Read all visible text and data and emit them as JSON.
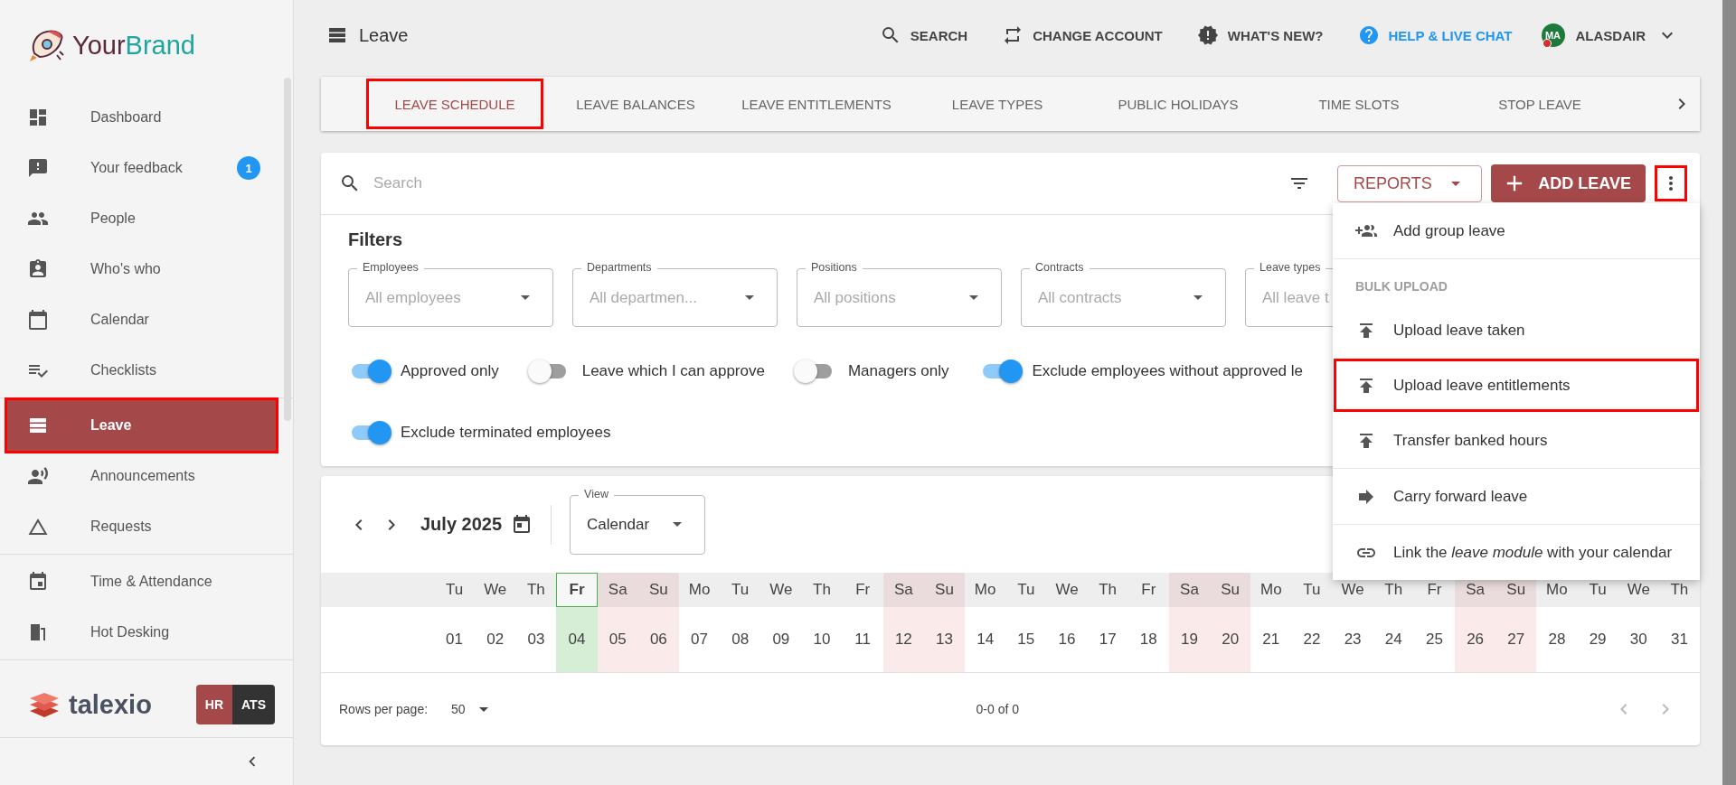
{
  "sidebar": {
    "brand": {
      "first": "Your",
      "second": "Brand"
    },
    "nav_sections": [
      {
        "items": [
          {
            "label": "Dashboard",
            "selected": false,
            "highlighted": false
          },
          {
            "label": "Your feedback",
            "selected": false,
            "highlighted": false,
            "badge": "1"
          },
          {
            "label": "People",
            "selected": false,
            "highlighted": false
          },
          {
            "label": "Who's who",
            "selected": false,
            "highlighted": false
          },
          {
            "label": "Calendar",
            "selected": false,
            "highlighted": false
          },
          {
            "label": "Checklists",
            "selected": false,
            "highlighted": false
          }
        ]
      },
      {
        "items": [
          {
            "label": "Leave",
            "selected": true,
            "highlighted": true
          },
          {
            "label": "Announcements",
            "selected": false,
            "highlighted": false
          },
          {
            "label": "Requests",
            "selected": false,
            "highlighted": false
          }
        ]
      },
      {
        "items": [
          {
            "label": "Time & Attendance",
            "selected": false,
            "highlighted": false
          },
          {
            "label": "Hot Desking",
            "selected": false,
            "highlighted": false
          }
        ]
      }
    ],
    "footer": {
      "product": "talexio",
      "modules": [
        {
          "label": "HR",
          "selected": true
        },
        {
          "label": "ATS",
          "selected": false
        }
      ]
    }
  },
  "header": {
    "title": "Leave",
    "actions": [
      {
        "label": "SEARCH",
        "kind": "plain"
      },
      {
        "label": "CHANGE ACCOUNT",
        "kind": "plain"
      },
      {
        "label": "WHAT'S NEW?",
        "kind": "plain"
      },
      {
        "label": "HELP & LIVE CHAT",
        "kind": "link"
      }
    ],
    "user": {
      "initials": "MA",
      "name": "ALASDAIR"
    }
  },
  "tabs": [
    {
      "label": "LEAVE SCHEDULE",
      "selected": true,
      "highlighted": true
    },
    {
      "label": "LEAVE BALANCES",
      "selected": false,
      "highlighted": false
    },
    {
      "label": "LEAVE ENTITLEMENTS",
      "selected": false,
      "highlighted": false
    },
    {
      "label": "LEAVE TYPES",
      "selected": false,
      "highlighted": false
    },
    {
      "label": "PUBLIC HOLIDAYS",
      "selected": false,
      "highlighted": false
    },
    {
      "label": "TIME SLOTS",
      "selected": false,
      "highlighted": false
    },
    {
      "label": "STOP LEAVE",
      "selected": false,
      "highlighted": false
    }
  ],
  "toolbar": {
    "search": {
      "placeholder": "Search"
    },
    "reports_button": "REPORTS",
    "add_button": "ADD LEAVE",
    "more_button": {
      "highlighted": true
    }
  },
  "filters": {
    "title": "Filters",
    "dropdowns": [
      {
        "label": "Employees",
        "placeholder": "All employees"
      },
      {
        "label": "Departments",
        "placeholder": "All departmen..."
      },
      {
        "label": "Positions",
        "placeholder": "All positions"
      },
      {
        "label": "Contracts",
        "placeholder": "All contracts"
      },
      {
        "label": "Leave types",
        "placeholder": "All leave t"
      }
    ],
    "switches": [
      {
        "label": "Approved only",
        "on": true
      },
      {
        "label": "Leave which I can approve",
        "on": false
      },
      {
        "label": "Managers only",
        "on": false
      },
      {
        "label": "Exclude employees without approved le",
        "on": true
      },
      {
        "label": "Exclude terminated employees",
        "on": true
      }
    ]
  },
  "menu": {
    "sections": [
      {
        "items": [
          {
            "label": "Add group leave",
            "highlighted": false
          }
        ]
      },
      {
        "title": "BULK UPLOAD",
        "items": [
          {
            "label": "Upload leave taken",
            "highlighted": false
          },
          {
            "label": "Upload leave entitlements",
            "highlighted": true
          },
          {
            "label": "Transfer banked hours",
            "highlighted": false
          }
        ]
      },
      {
        "items": [
          {
            "label": "Carry forward leave",
            "highlighted": false
          }
        ]
      },
      {
        "items": [
          {
            "label": "Link the *leave module* with your calendar",
            "highlighted": false
          }
        ]
      }
    ]
  },
  "calendar": {
    "month": "July 2025",
    "view": {
      "label": "View",
      "value": "Calendar"
    },
    "days": [
      {
        "weekday": "Tu",
        "date": "01",
        "weekend": false,
        "today": false
      },
      {
        "weekday": "We",
        "date": "02",
        "weekend": false,
        "today": false
      },
      {
        "weekday": "Th",
        "date": "03",
        "weekend": false,
        "today": false
      },
      {
        "weekday": "Fr",
        "date": "04",
        "weekend": false,
        "today": true
      },
      {
        "weekday": "Sa",
        "date": "05",
        "weekend": true,
        "today": false
      },
      {
        "weekday": "Su",
        "date": "06",
        "weekend": true,
        "today": false
      },
      {
        "weekday": "Mo",
        "date": "07",
        "weekend": false,
        "today": false
      },
      {
        "weekday": "Tu",
        "date": "08",
        "weekend": false,
        "today": false
      },
      {
        "weekday": "We",
        "date": "09",
        "weekend": false,
        "today": false
      },
      {
        "weekday": "Th",
        "date": "10",
        "weekend": false,
        "today": false
      },
      {
        "weekday": "Fr",
        "date": "11",
        "weekend": false,
        "today": false
      },
      {
        "weekday": "Sa",
        "date": "12",
        "weekend": true,
        "today": false
      },
      {
        "weekday": "Su",
        "date": "13",
        "weekend": true,
        "today": false
      },
      {
        "weekday": "Mo",
        "date": "14",
        "weekend": false,
        "today": false
      },
      {
        "weekday": "Tu",
        "date": "15",
        "weekend": false,
        "today": false
      },
      {
        "weekday": "We",
        "date": "16",
        "weekend": false,
        "today": false
      },
      {
        "weekday": "Th",
        "date": "17",
        "weekend": false,
        "today": false
      },
      {
        "weekday": "Fr",
        "date": "18",
        "weekend": false,
        "today": false
      },
      {
        "weekday": "Sa",
        "date": "19",
        "weekend": true,
        "today": false
      },
      {
        "weekday": "Su",
        "date": "20",
        "weekend": true,
        "today": false
      },
      {
        "weekday": "Mo",
        "date": "21",
        "weekend": false,
        "today": false
      },
      {
        "weekday": "Tu",
        "date": "22",
        "weekend": false,
        "today": false
      },
      {
        "weekday": "We",
        "date": "23",
        "weekend": false,
        "today": false
      },
      {
        "weekday": "Th",
        "date": "24",
        "weekend": false,
        "today": false
      },
      {
        "weekday": "Fr",
        "date": "25",
        "weekend": false,
        "today": false
      },
      {
        "weekday": "Sa",
        "date": "26",
        "weekend": true,
        "today": false
      },
      {
        "weekday": "Su",
        "date": "27",
        "weekend": true,
        "today": false
      },
      {
        "weekday": "Mo",
        "date": "28",
        "weekend": false,
        "today": false
      },
      {
        "weekday": "Tu",
        "date": "29",
        "weekend": false,
        "today": false
      },
      {
        "weekday": "We",
        "date": "30",
        "weekend": false,
        "today": false
      },
      {
        "weekday": "Th",
        "date": "31",
        "weekend": false,
        "today": false
      }
    ],
    "footer": {
      "rows_label": "Rows per page:",
      "rows_value": "50",
      "range": "0-0 of 0"
    }
  }
}
